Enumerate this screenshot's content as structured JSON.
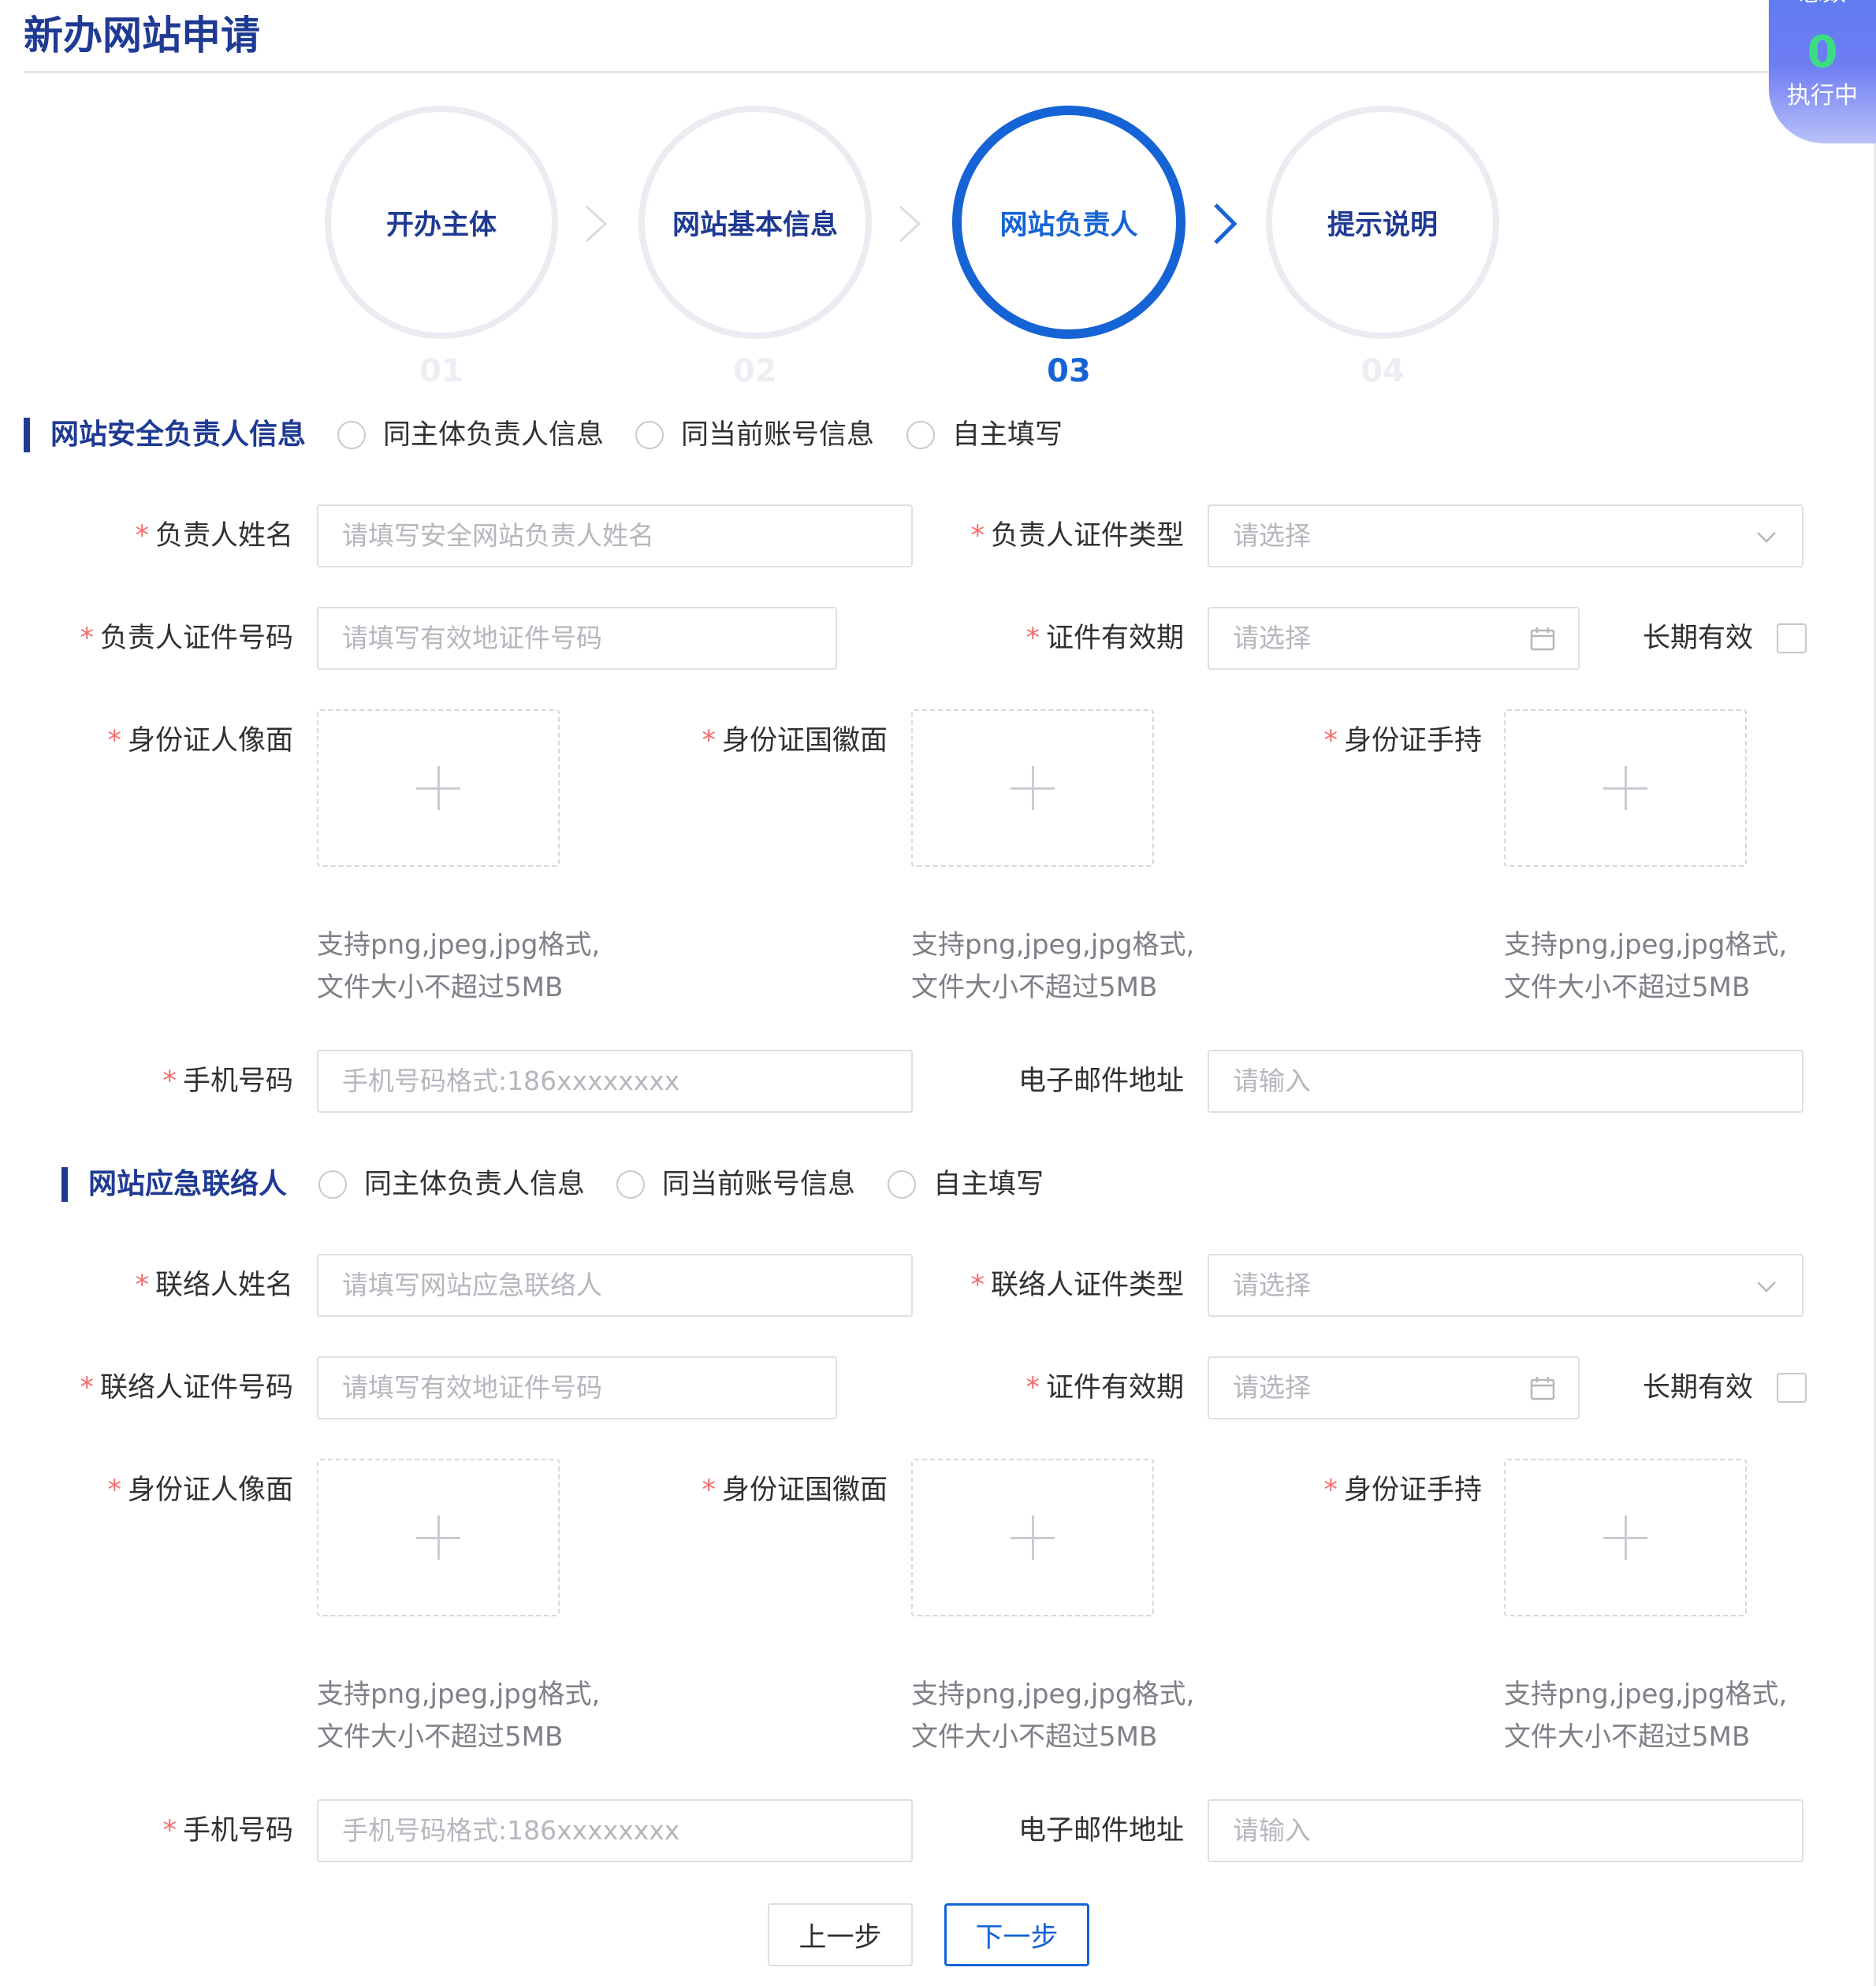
{
  "page": {
    "title": "新办网站申请"
  },
  "task_badge": {
    "top_label": "总数",
    "count": "0",
    "status": "执行中"
  },
  "steps": [
    {
      "label": "开办主体",
      "number": "01"
    },
    {
      "label": "网站基本信息",
      "number": "02"
    },
    {
      "label": "网站负责人",
      "number": "03"
    },
    {
      "label": "提示说明",
      "number": "04"
    }
  ],
  "active_step": 3,
  "sections": [
    {
      "title": "网站安全负责人信息",
      "radio_options": [
        "同主体负责人信息",
        "同当前账号信息",
        "自主填写"
      ],
      "fields": {
        "name_label": "负责人姓名",
        "name_placeholder": "请填写安全网站负责人姓名",
        "cert_type_label": "负责人证件类型",
        "cert_type_placeholder": "请选择",
        "cert_no_label": "负责人证件号码",
        "cert_no_placeholder": "请填写有效地证件号码",
        "validity_label": "证件有效期",
        "validity_placeholder": "请选择",
        "long_term_label": "长期有效",
        "front_label": "身份证人像面",
        "back_label": "身份证国徽面",
        "hand_label": "身份证手持",
        "hint_line1": "支持png,jpeg,jpg格式,",
        "hint_line2": "文件大小不超过5MB",
        "phone_label": "手机号码",
        "phone_placeholder": "手机号码格式:186xxxxxxxx",
        "email_label": "电子邮件地址",
        "email_placeholder": "请输入"
      }
    },
    {
      "title": "网站应急联络人",
      "radio_options": [
        "同主体负责人信息",
        "同当前账号信息",
        "自主填写"
      ],
      "fields": {
        "name_label": "联络人姓名",
        "name_placeholder": "请填写网站应急联络人",
        "cert_type_label": "联络人证件类型",
        "cert_type_placeholder": "请选择",
        "cert_no_label": "联络人证件号码",
        "cert_no_placeholder": "请填写有效地证件号码",
        "validity_label": "证件有效期",
        "validity_placeholder": "请选择",
        "long_term_label": "长期有效",
        "front_label": "身份证人像面",
        "back_label": "身份证国徽面",
        "hand_label": "身份证手持",
        "hint_line1": "支持png,jpeg,jpg格式,",
        "hint_line2": "文件大小不超过5MB",
        "phone_label": "手机号码",
        "phone_placeholder": "手机号码格式:186xxxxxxxx",
        "email_label": "电子邮件地址",
        "email_placeholder": "请输入"
      }
    }
  ],
  "required_mark": "*",
  "buttons": {
    "prev": "上一步",
    "next": "下一步"
  },
  "colors": {
    "brand": "#1f3a93",
    "active": "#1663d6",
    "required": "#f56c6c",
    "count": "#3ddc84"
  },
  "icons": [
    "chevron-right-icon",
    "chevron-down-icon",
    "calendar-icon",
    "plus-icon"
  ]
}
